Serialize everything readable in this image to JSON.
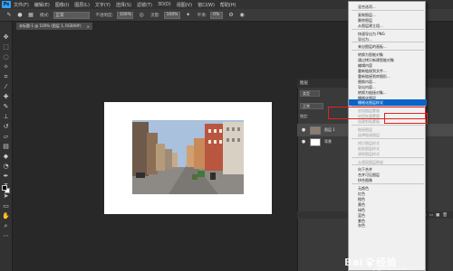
{
  "menubar": {
    "logo": "Ps",
    "items": [
      "文件(F)",
      "编辑(E)",
      "图像(I)",
      "图层(L)",
      "文字(Y)",
      "选择(S)",
      "滤镜(T)",
      "3D(D)",
      "视图(V)",
      "窗口(W)",
      "帮助(H)"
    ]
  },
  "options": {
    "mode_label": "模式:",
    "mode_value": "正常",
    "opacity_label": "不透明度:",
    "opacity_value": "100%",
    "flow_label": "流量:",
    "flow_value": "100%",
    "smooth_label": "平滑:",
    "smooth_value": "0%"
  },
  "document": {
    "tab_label": "未标题-1 @ 100% (图层 1, RGB/8#)",
    "close": "×"
  },
  "layers_panel": {
    "title": "图层",
    "kind_label": "类型",
    "blend_mode": "正常",
    "lock_label": "锁定:",
    "layers": [
      {
        "name": "图层 1",
        "eye": "●"
      },
      {
        "name": "背景",
        "eye": "●"
      }
    ],
    "footer_icons": [
      "fx",
      "◐",
      "▭",
      "■",
      "🗑"
    ]
  },
  "context_menu": {
    "items": [
      {
        "label": "混合选项...",
        "state": "normal"
      },
      {
        "sep": true
      },
      {
        "label": "复制图层...",
        "state": "normal"
      },
      {
        "label": "删除图层",
        "state": "normal"
      },
      {
        "label": "从图层建立组...",
        "state": "normal"
      },
      {
        "sep": true
      },
      {
        "label": "快速导出为 PNG",
        "state": "normal"
      },
      {
        "label": "导出为...",
        "state": "normal"
      },
      {
        "sep": true
      },
      {
        "label": "来自图层的画板...",
        "state": "normal"
      },
      {
        "sep": true
      },
      {
        "label": "转换为智能对象",
        "state": "normal"
      },
      {
        "label": "通过拷贝新建智能对象",
        "state": "normal"
      },
      {
        "label": "编辑内容",
        "state": "normal"
      },
      {
        "label": "重新链接到文件...",
        "state": "normal"
      },
      {
        "label": "重新链接到库图形...",
        "state": "normal"
      },
      {
        "label": "替换内容...",
        "state": "normal"
      },
      {
        "label": "导出内容...",
        "state": "normal"
      },
      {
        "label": "转换为链接对象...",
        "state": "normal"
      },
      {
        "label": "栅格化图层",
        "state": "normal"
      },
      {
        "label": "栅格化图层样式",
        "state": "highlight"
      },
      {
        "sep": true
      },
      {
        "label": "启用图层蒙版",
        "state": "disabled"
      },
      {
        "label": "启用矢量蒙版",
        "state": "disabled"
      },
      {
        "label": "创建剪贴蒙版",
        "state": "disabled"
      },
      {
        "sep": true
      },
      {
        "label": "链接图层",
        "state": "disabled"
      },
      {
        "label": "选择链接图层",
        "state": "disabled"
      },
      {
        "sep": true
      },
      {
        "label": "拷贝图层样式",
        "state": "disabled"
      },
      {
        "label": "粘贴图层样式",
        "state": "disabled"
      },
      {
        "label": "清除图层样式",
        "state": "disabled"
      },
      {
        "sep": true
      },
      {
        "label": "从隔离图层释放",
        "state": "disabled"
      },
      {
        "sep": true
      },
      {
        "label": "向下合并",
        "state": "normal"
      },
      {
        "label": "合并可见图层",
        "state": "normal"
      },
      {
        "label": "拼合图像",
        "state": "normal"
      },
      {
        "sep": true
      },
      {
        "label": "无颜色",
        "state": "normal"
      },
      {
        "label": "红色",
        "state": "normal"
      },
      {
        "label": "橙色",
        "state": "normal"
      },
      {
        "label": "黄色",
        "state": "normal"
      },
      {
        "label": "绿色",
        "state": "normal"
      },
      {
        "label": "蓝色",
        "state": "normal"
      },
      {
        "label": "紫色",
        "state": "normal"
      },
      {
        "label": "灰色",
        "state": "normal"
      }
    ]
  },
  "watermark": {
    "brand": "Bai",
    "brand2": "经验",
    "sub": "jingyan.baidu.com"
  },
  "colors": {
    "accent": "#0a64c8",
    "highlight_box": "#e42222",
    "ps_blue": "#2fa3f7"
  }
}
